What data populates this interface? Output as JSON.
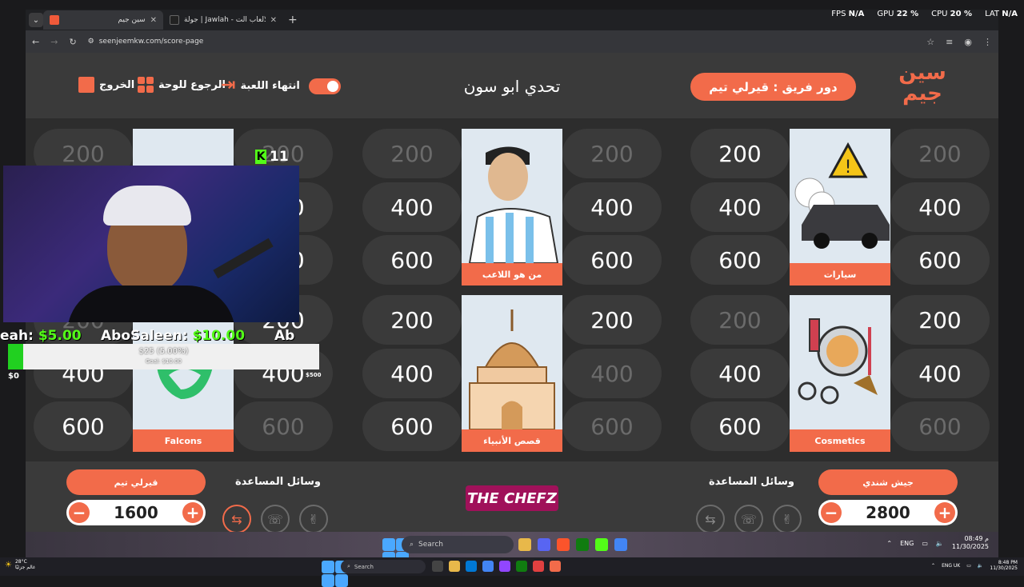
{
  "browser": {
    "tabs": [
      {
        "title": "سين جيم",
        "active": true
      },
      {
        "title": "جولة | Jawlah - منصة الألعاب الت...",
        "active": false
      }
    ],
    "url": "seenjeemkw.com/score-page",
    "stats": {
      "fps_label": "FPS",
      "fps": "N/A",
      "gpu_label": "GPU",
      "gpu": "22 %",
      "cpu_label": "CPU",
      "cpu": "20 %",
      "lat_label": "LAT",
      "lat": "N/A"
    }
  },
  "header": {
    "exit_label": "الخروج",
    "back_to_board_label": "الرجوع للوحة",
    "end_game_label": "انتهاء اللعبة",
    "title": "تحدي ابو سون",
    "turn_text": "دور فريق : قيرلي تيم",
    "logo_text": "سين جيم"
  },
  "categories": [
    {
      "label": "Cosmetics",
      "left": [
        {
          "v": "200",
          "used": true
        },
        {
          "v": "400",
          "used": false
        },
        {
          "v": "600",
          "used": false
        }
      ],
      "right": [
        {
          "v": "200",
          "used": false
        },
        {
          "v": "400",
          "used": false
        },
        {
          "v": "600",
          "used": true
        }
      ]
    },
    {
      "label": "قصص الأنبياء",
      "left": [
        {
          "v": "200",
          "used": false
        },
        {
          "v": "400",
          "used": false
        },
        {
          "v": "600",
          "used": false
        }
      ],
      "right": [
        {
          "v": "200",
          "used": false
        },
        {
          "v": "400",
          "used": true
        },
        {
          "v": "600",
          "used": true
        }
      ]
    },
    {
      "label": "Falcons",
      "left": [
        {
          "v": "200",
          "used": true
        },
        {
          "v": "400",
          "used": false
        },
        {
          "v": "600",
          "used": false
        }
      ],
      "right": [
        {
          "v": "200",
          "used": false
        },
        {
          "v": "400",
          "used": false
        },
        {
          "v": "600",
          "used": true
        }
      ]
    },
    {
      "label": "سيارات",
      "left": [
        {
          "v": "200",
          "used": false
        },
        {
          "v": "400",
          "used": false
        },
        {
          "v": "600",
          "used": false
        }
      ],
      "right": [
        {
          "v": "200",
          "used": true
        },
        {
          "v": "400",
          "used": false
        },
        {
          "v": "600",
          "used": false
        }
      ]
    },
    {
      "label": "من هو اللاعب",
      "left": [
        {
          "v": "200",
          "used": true
        },
        {
          "v": "400",
          "used": false
        },
        {
          "v": "600",
          "used": false
        }
      ],
      "right": [
        {
          "v": "200",
          "used": true
        },
        {
          "v": "400",
          "used": false
        },
        {
          "v": "600",
          "used": false
        }
      ]
    },
    {
      "label": "",
      "left": [
        {
          "v": "200",
          "used": true
        },
        {
          "v": "400",
          "used": false
        },
        {
          "v": "600",
          "used": false
        }
      ],
      "right": [
        {
          "v": "200",
          "used": true
        },
        {
          "v": "400",
          "used": false
        },
        {
          "v": "600",
          "used": false
        }
      ]
    }
  ],
  "footer": {
    "team_left": {
      "name": "قيرلي تيم",
      "score": "1600",
      "minus": "−",
      "plus": "+"
    },
    "team_right": {
      "name": "جيش شندي",
      "score": "2800",
      "minus": "−",
      "plus": "+"
    },
    "aids_label": "وسائل المساعدة",
    "sponsor": "THE CHEFZ"
  },
  "overlay": {
    "kick_count": "11",
    "kick_letter": "K",
    "donation_1_name": "eah:",
    "donation_1_amount": "$5.00",
    "donation_2_name": "AboSaleen:",
    "donation_2_amount": "$10.00",
    "donation_3_name": "Ab",
    "goal_label": "$25 (5.00%)",
    "goal_sub": "Goal: $10.00",
    "goal_progress": 0.05,
    "goal_min": "$0",
    "goal_max": "$500"
  },
  "taskbar": {
    "inner_search": "Search",
    "inner_lang": "ENG",
    "inner_time": "08:49 م",
    "inner_date": "11/30/2025",
    "outer_search": "Search",
    "weather_temp": "28°C",
    "weather_text": "غالم جزئيًا",
    "outer_lang": "ENG UK",
    "outer_time": "8:48 PM",
    "outer_date": "11/30/2025"
  },
  "colors": {
    "accent": "#f26b4a",
    "page_bg": "#2d2d2d",
    "panel": "#3a3a3a",
    "used_text": "#6b6b6b"
  }
}
